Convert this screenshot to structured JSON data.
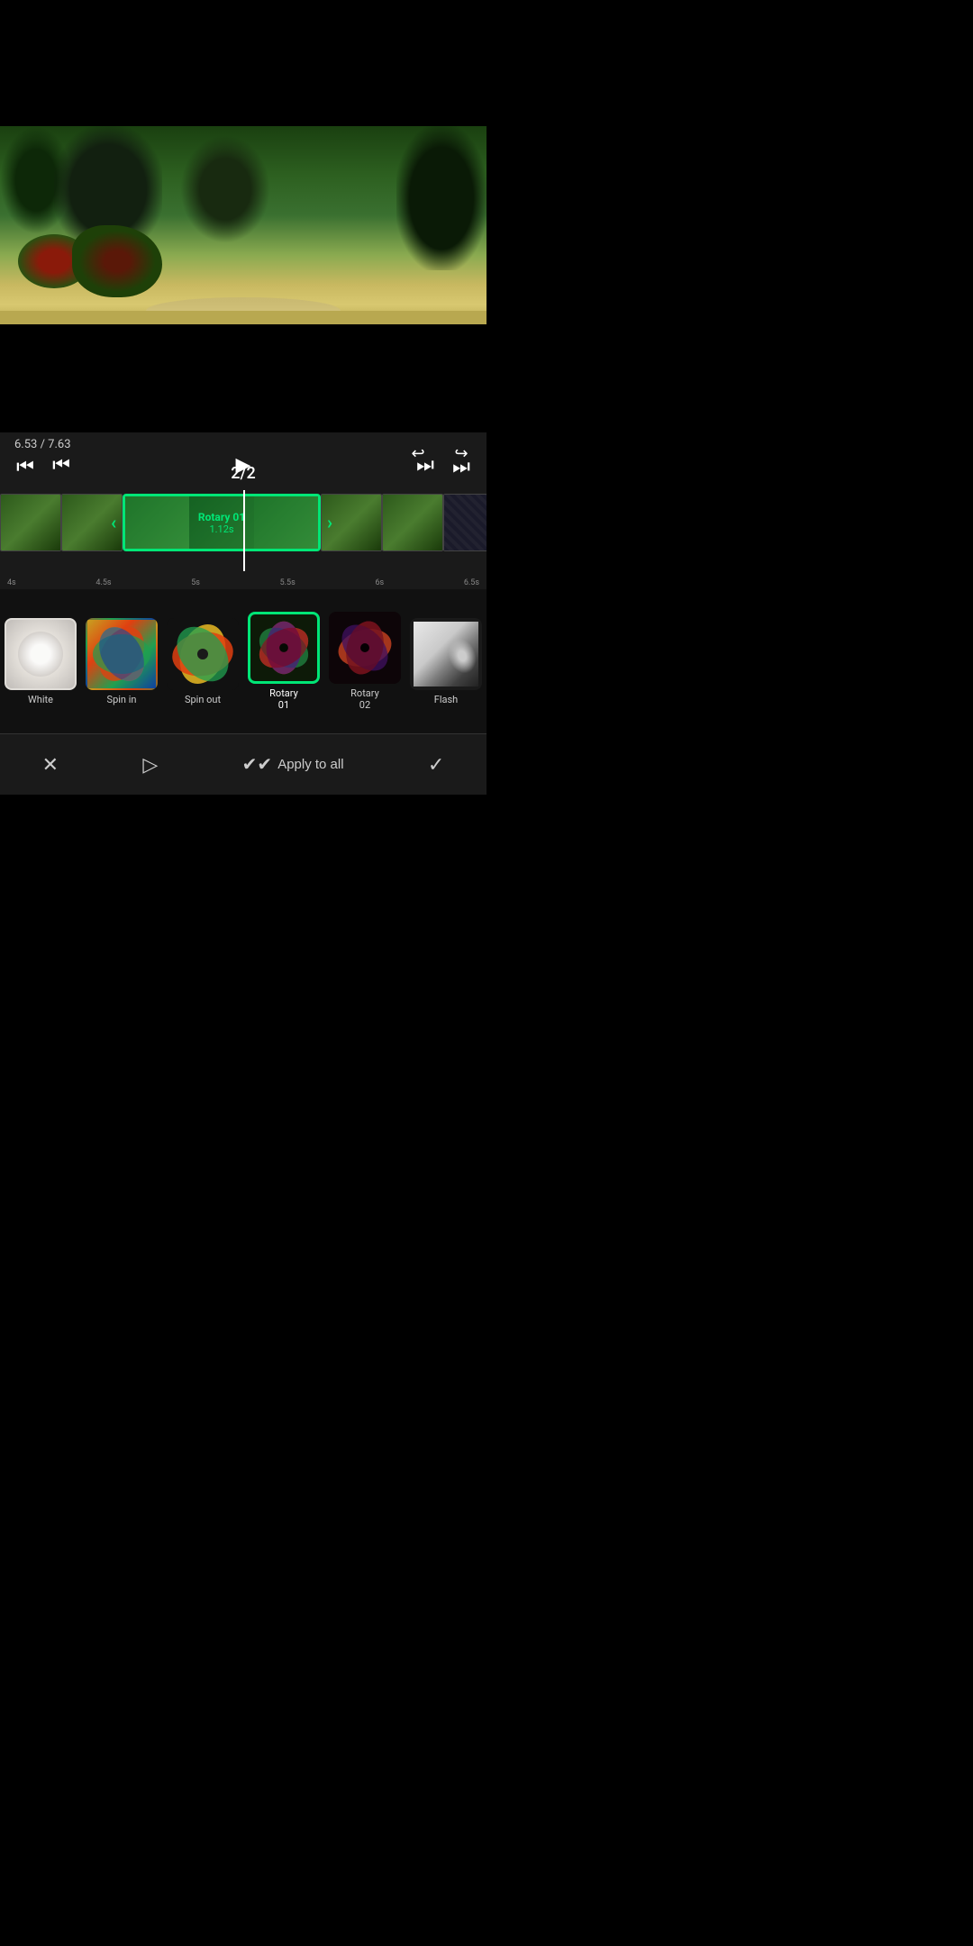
{
  "videoArea": {
    "backgroundColor": "#000"
  },
  "controls": {
    "timeDisplay": "6.53 / 7.63",
    "clipCounter": "2/2",
    "undoLabel": "↩",
    "redoLabel": "↪",
    "skipToStartLabel": "⏮",
    "playLabel": "▶",
    "skipToEndLabel": "⏭",
    "prevClipLabel": "⏮",
    "nextClipLabel": "⏭"
  },
  "timeline": {
    "selectedTransition": {
      "name": "Rotary 01",
      "duration": "1.12s"
    },
    "rulerMarks": [
      "4s",
      "4.5s",
      "5s",
      "5.5s",
      "6s",
      "6.5s"
    ]
  },
  "transitions": [
    {
      "id": "white",
      "name": "White",
      "active": false
    },
    {
      "id": "spin-in",
      "name": "Spin in",
      "active": false
    },
    {
      "id": "spin-out",
      "name": "Spin out",
      "active": false
    },
    {
      "id": "rotary-01",
      "name": "Rotary\n01",
      "nameDisplay": "Rotary 01",
      "active": true
    },
    {
      "id": "rotary-02",
      "name": "Rotary\n02",
      "nameDisplay": "Rotary 02",
      "active": false
    },
    {
      "id": "flash",
      "name": "Flash",
      "active": false
    }
  ],
  "bottomBar": {
    "cancelLabel": "✕",
    "previewLabel": "▷",
    "applyAllLabel": "Apply to all",
    "confirmLabel": "✓"
  }
}
